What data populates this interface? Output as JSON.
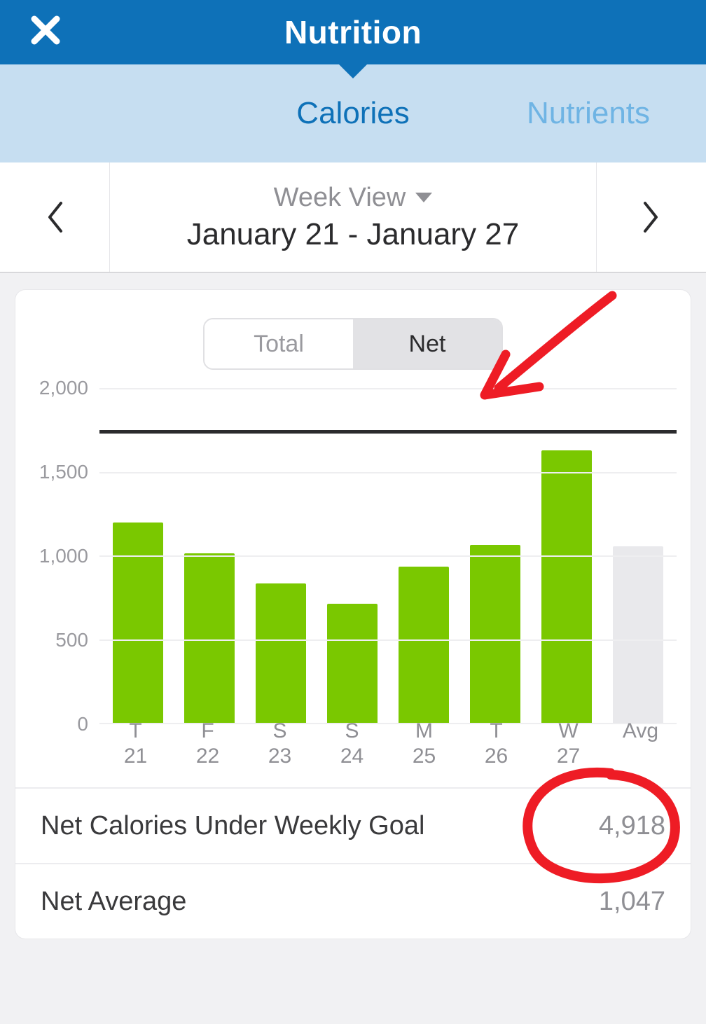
{
  "header": {
    "title": "Nutrition"
  },
  "tabs": {
    "left": "Calories",
    "right": "Nutrients",
    "active": "Calories"
  },
  "date_nav": {
    "view_label": "Week View",
    "range": "January 21 - January 27"
  },
  "segment": {
    "left": "Total",
    "right": "Net",
    "active": "Net"
  },
  "y_ticks": [
    "0",
    "500",
    "1,000",
    "1,500",
    "2,000"
  ],
  "goal_line_value": 1750,
  "chart_data": {
    "type": "bar",
    "title": "",
    "xlabel": "",
    "ylabel": "",
    "ylim": [
      0,
      2000
    ],
    "grid": true,
    "categories": [
      "T",
      "F",
      "S",
      "S",
      "M",
      "T",
      "W",
      "Avg"
    ],
    "day_numbers": [
      "21",
      "22",
      "23",
      "24",
      "25",
      "26",
      "27",
      ""
    ],
    "series": [
      {
        "name": "Net Calories",
        "values": [
          1190,
          1010,
          830,
          710,
          930,
          1060,
          1620,
          1050
        ]
      }
    ],
    "avg_index": 7
  },
  "stats": {
    "under_goal": {
      "label": "Net Calories Under Weekly Goal",
      "value": "4,918"
    },
    "net_avg": {
      "label": "Net Average",
      "value": "1,047"
    }
  },
  "colors": {
    "brand": "#0e71b8",
    "bar": "#7ac800",
    "annotation": "#ee1c25"
  }
}
